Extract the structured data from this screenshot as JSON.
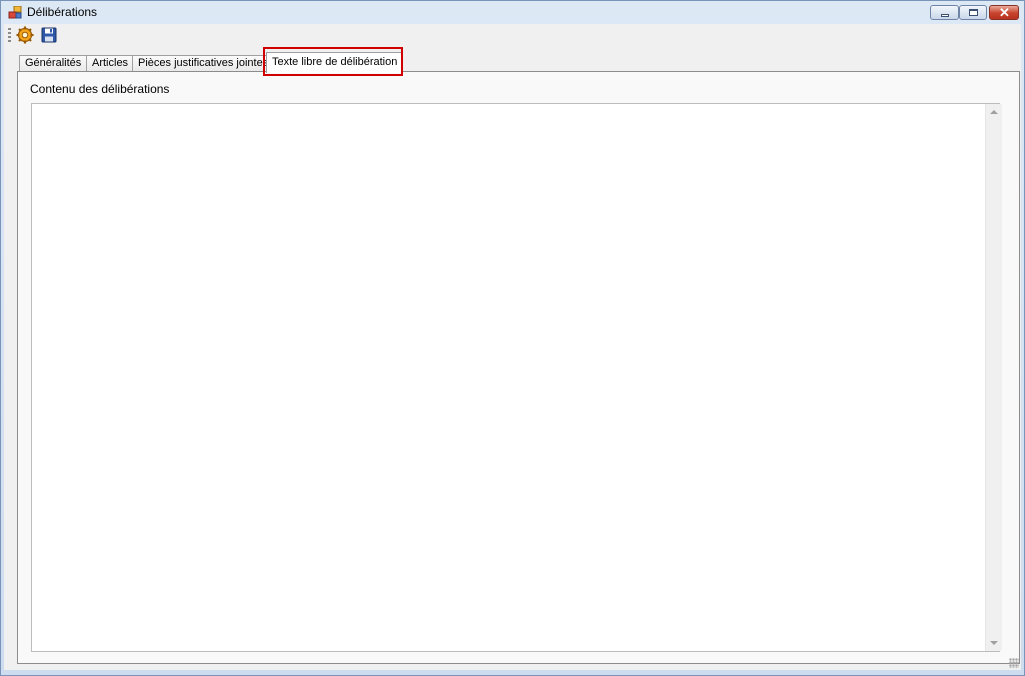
{
  "window": {
    "title": "Délibérations",
    "accent_color": "#d00000"
  },
  "toolbar": {
    "buttons": [
      {
        "icon": "gear-icon"
      },
      {
        "icon": "save-icon"
      }
    ]
  },
  "tabs": [
    {
      "label": "Généralités",
      "selected": false
    },
    {
      "label": "Articles",
      "selected": false
    },
    {
      "label": "Pièces justificatives jointes",
      "selected": false
    },
    {
      "label": "Texte libre de délibération",
      "selected": true
    }
  ],
  "content": {
    "label": "Contenu des délibérations",
    "value": ""
  }
}
